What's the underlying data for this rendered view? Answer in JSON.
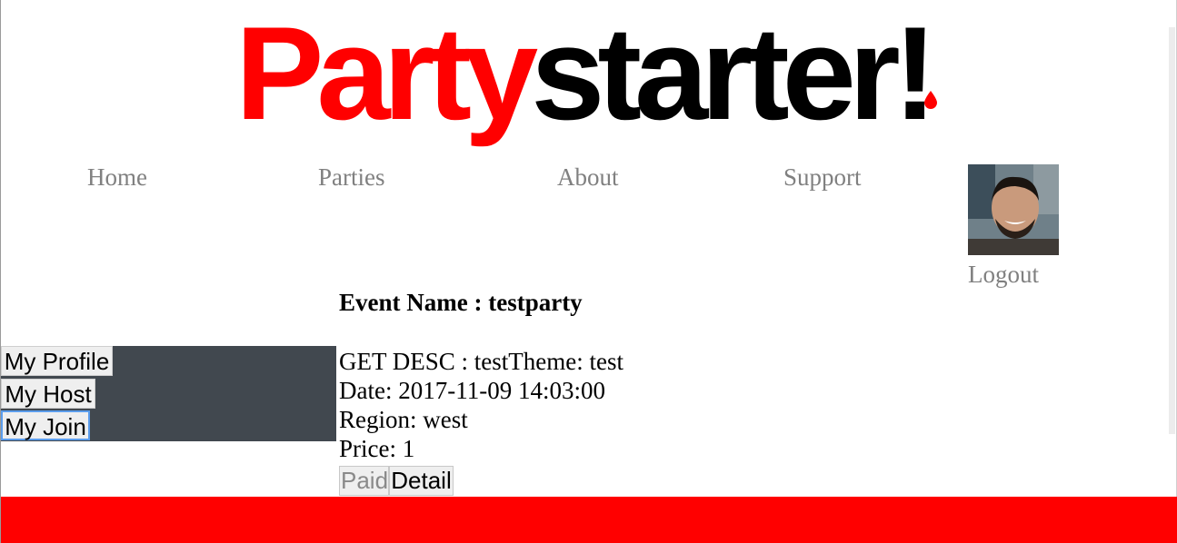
{
  "logo": {
    "part1": "Party",
    "part2": "starter",
    "part3": "!"
  },
  "nav": {
    "home": "Home",
    "parties": "Parties",
    "about": "About",
    "support": "Support",
    "logout": "Logout"
  },
  "sidebar": {
    "profile": "My Profile",
    "host": "My Host",
    "join": "My Join"
  },
  "event": {
    "title": "Event Name : testparty",
    "desc": "GET DESC : testTheme: test",
    "date": "Date: 2017-11-09 14:03:00",
    "region": "Region: west",
    "price": "Price: 1",
    "paid_label": "Paid",
    "detail_label": "Detail"
  },
  "colors": {
    "brand_red": "#ff0000",
    "sidebar_bg": "#41484f",
    "nav_gray": "#808080"
  }
}
